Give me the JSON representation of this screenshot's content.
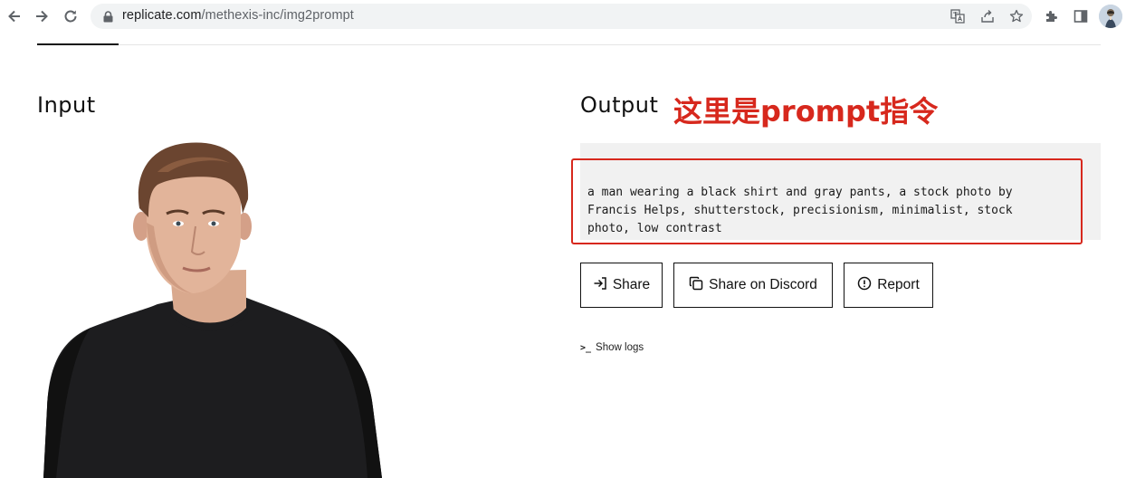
{
  "browser": {
    "url_host": "replicate.com",
    "url_path": "/methexis-inc/img2prompt",
    "icons": [
      "back-icon",
      "forward-icon",
      "reload-icon",
      "lock-icon",
      "translate-icon",
      "share-page-icon",
      "bookmark-star-icon",
      "extensions-icon",
      "side-panel-icon",
      "profile-avatar"
    ]
  },
  "input": {
    "title": "Input"
  },
  "output": {
    "title": "Output",
    "annotation": "这里是prompt指令",
    "text": "a man wearing a black shirt and gray pants, a stock photo by\nFrancis Helps, shutterstock, precisionism, minimalist, stock\nphoto, low contrast"
  },
  "actions": {
    "share": "Share",
    "share_discord": "Share on Discord",
    "report": "Report"
  },
  "logs": {
    "label": "Show logs"
  },
  "colors": {
    "annotation_red": "#d7281d",
    "output_bg": "#f1f1f1",
    "omnibox_bg": "#f1f3f4"
  }
}
